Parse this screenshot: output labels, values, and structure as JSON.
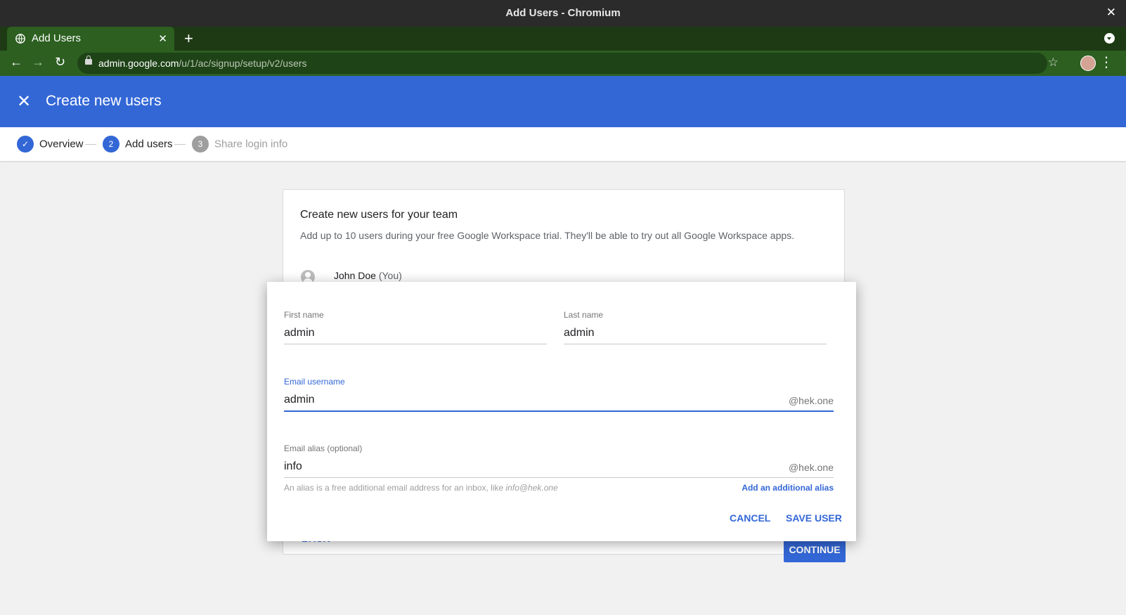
{
  "window": {
    "title": "Add Users - Chromium"
  },
  "browser": {
    "tab_title": "Add Users",
    "url_host": "admin.google.com",
    "url_path": "/u/1/ac/signup/setup/v2/users"
  },
  "header": {
    "title": "Create new users"
  },
  "stepper": {
    "steps": [
      {
        "number": "",
        "label": "Overview",
        "state": "done"
      },
      {
        "number": "2",
        "label": "Add users",
        "state": "active"
      },
      {
        "number": "3",
        "label": "Share login info",
        "state": "pending"
      }
    ]
  },
  "card": {
    "heading": "Create new users for your team",
    "subtext": "Add up to 10 users during your free Google Workspace trial. They'll be able to try out all Google Workspace apps.",
    "user_name": "John Doe",
    "user_tag": "(You)",
    "back_label": "BACK",
    "continue_label": "CONTINUE"
  },
  "dialog": {
    "first_name": {
      "label": "First name",
      "value": "admin"
    },
    "last_name": {
      "label": "Last name",
      "value": "admin"
    },
    "email_username": {
      "label": "Email username",
      "value": "admin",
      "suffix": "@hek.one"
    },
    "email_alias": {
      "label": "Email alias (optional)",
      "value": "info",
      "suffix": "@hek.one"
    },
    "alias_hint": "An alias is a free additional email address for an inbox, like",
    "alias_hint_example": "info@hek.one",
    "add_alias_label": "Add an additional alias",
    "cancel_label": "CANCEL",
    "save_label": "SAVE USER"
  },
  "colors": {
    "brand_blue": "#3367d6",
    "browser_green": "#2c5f20"
  }
}
